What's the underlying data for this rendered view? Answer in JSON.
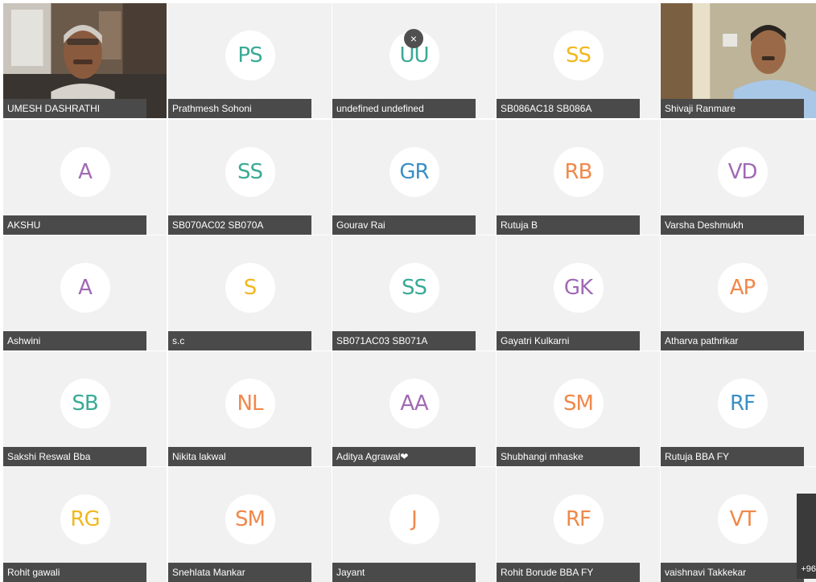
{
  "participants": [
    {
      "name": "UMESH DASHRATHI",
      "video": "video-feed-man-office",
      "initials": ""
    },
    {
      "name": "Prathmesh Sohoni",
      "initials": "PS",
      "color": "#3aaa96"
    },
    {
      "name": "undefined undefined",
      "initials": "UU",
      "color": "#3aaa96"
    },
    {
      "name": "SB086AC18 SB086A",
      "initials": "SS",
      "color": "#f1b81e"
    },
    {
      "name": "Shivaji Ranmare",
      "video": "video-feed-man-room",
      "initials": ""
    },
    {
      "name": "AKSHU",
      "initials": "A",
      "color": "#a06ab4"
    },
    {
      "name": "SB070AC02 SB070A",
      "initials": "SS",
      "color": "#3aaa96"
    },
    {
      "name": "Gourav Rai",
      "initials": "GR",
      "color": "#3a8fc4"
    },
    {
      "name": "Rutuja B",
      "initials": "RB",
      "color": "#f0884a"
    },
    {
      "name": "Varsha Deshmukh",
      "initials": "VD",
      "color": "#a06ab4"
    },
    {
      "name": "Ashwini",
      "initials": "A",
      "color": "#a06ab4"
    },
    {
      "name": "s.c",
      "initials": "S",
      "color": "#f1b81e"
    },
    {
      "name": "SB071AC03 SB071A",
      "initials": "SS",
      "color": "#3aaa96"
    },
    {
      "name": "Gayatri Kulkarni",
      "initials": "GK",
      "color": "#a06ab4"
    },
    {
      "name": "Atharva pathrikar",
      "initials": "AP",
      "color": "#f0884a"
    },
    {
      "name": "Sakshi Reswal Bba",
      "initials": "SB",
      "color": "#3aaa96"
    },
    {
      "name": "Nikita lakwal",
      "initials": "NL",
      "color": "#f0884a"
    },
    {
      "name": "Aditya Agrawal❤",
      "initials": "AA",
      "color": "#a06ab4"
    },
    {
      "name": "Shubhangi mhaske",
      "initials": "SM",
      "color": "#f0884a"
    },
    {
      "name": "Rutuja BBA FY",
      "initials": "RF",
      "color": "#3a8fc4"
    },
    {
      "name": "Rohit gawali",
      "initials": "RG",
      "color": "#f1b81e"
    },
    {
      "name": "Snehlata Mankar",
      "initials": "SM",
      "color": "#f0884a"
    },
    {
      "name": "Jayant",
      "initials": "J",
      "color": "#f0884a"
    },
    {
      "name": "Rohit Borude BBA FY",
      "initials": "RF",
      "color": "#f0884a"
    },
    {
      "name": "vaishnavi Takkekar",
      "initials": "VT",
      "color": "#f0884a"
    }
  ],
  "close_icon": "×",
  "more_participants_label": "+96"
}
